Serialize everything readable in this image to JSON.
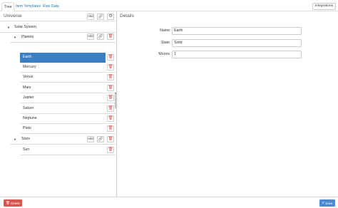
{
  "tabs": [
    {
      "label": "Tree",
      "active": true
    },
    {
      "label": "Item Templates",
      "active": false
    },
    {
      "label": "Raw Data",
      "active": false
    }
  ],
  "integrations_label": "Integrations",
  "left": {
    "title": "Universe",
    "add_label": "Add",
    "tree": {
      "solar_system": "Solar System",
      "planets": "Planets",
      "planet_items": [
        "Earth",
        "Mercury",
        "Venus",
        "Mars",
        "Jupiter",
        "Saturn",
        "Neptune",
        "Pluto"
      ],
      "selected": "Earth",
      "stars": "Stars",
      "star_items": [
        "Sun"
      ]
    }
  },
  "details": {
    "title": "Details",
    "fields": [
      {
        "label": "Name",
        "value": "Earth"
      },
      {
        "label": "State",
        "value": "Solid"
      },
      {
        "label": "Moons",
        "value": "1"
      }
    ]
  },
  "footer": {
    "delete_label": "Delete",
    "save_label": "Save"
  },
  "icons": {
    "link": "link-icon",
    "trash": "trash-icon",
    "settings": "cog-icon",
    "caret_down": "caret-down-icon"
  },
  "colors": {
    "selection": "#3a7fc4",
    "delete": "#d9534f",
    "save": "#4a8ad0",
    "link_text": "#2a7ab0"
  }
}
